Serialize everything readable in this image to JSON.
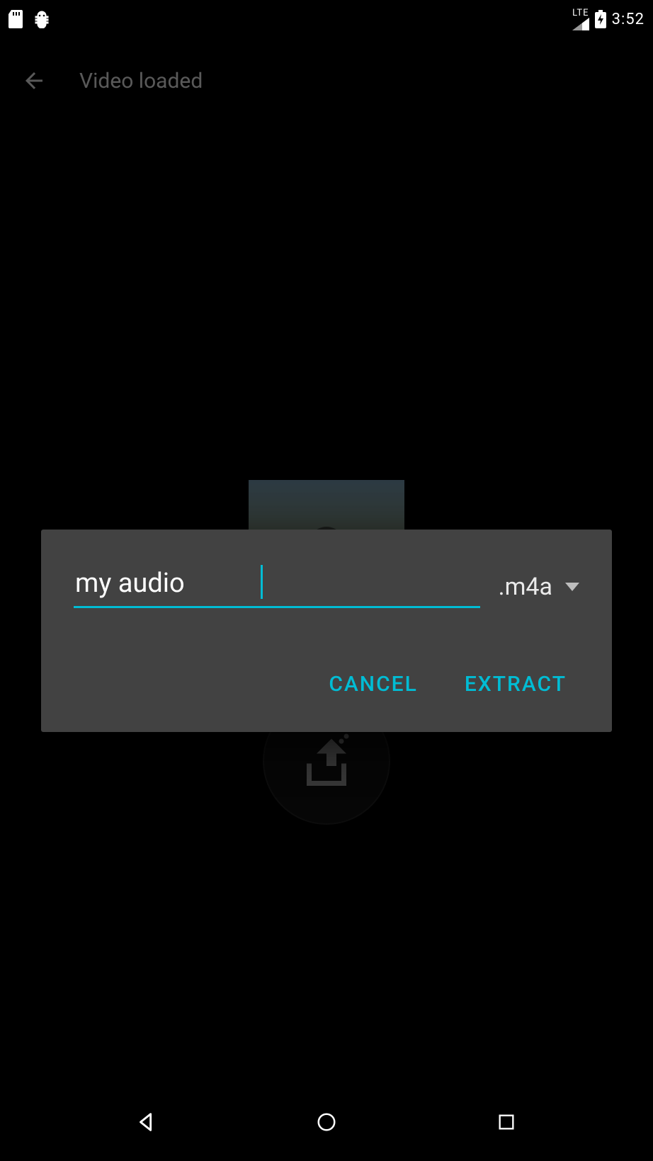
{
  "status": {
    "clock": "3:52",
    "lte": "LTE",
    "icons": [
      "sd-card-icon",
      "debug-icon",
      "lte-signal-icon",
      "battery-charging-icon"
    ]
  },
  "app_bar": {
    "title": "Video loaded"
  },
  "extract_button_label": "",
  "dialog": {
    "filename_value": "my audio",
    "extension_selected": ".m4a",
    "cancel_label": "CANCEL",
    "extract_label": "EXTRACT"
  },
  "colors": {
    "accent": "#00bcd4",
    "dialog_bg": "#424242"
  }
}
